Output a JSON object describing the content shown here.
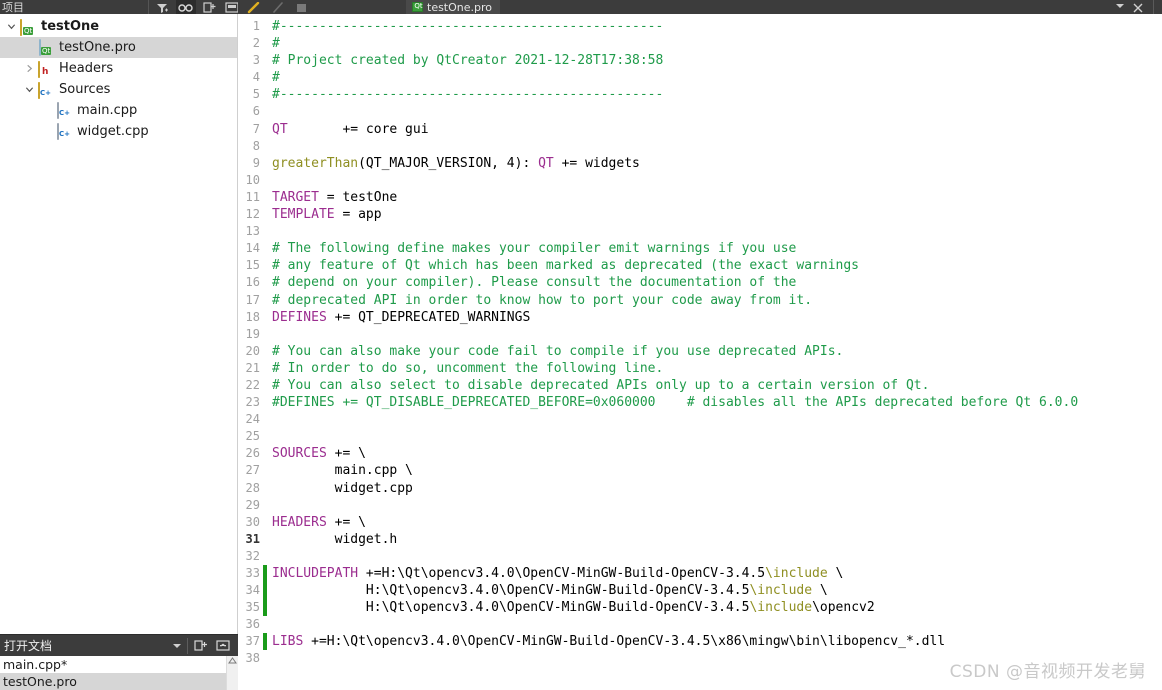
{
  "toolbar": {
    "projects_label": "项目",
    "filter_icon": "filter-icon",
    "link_icon": "link-with-editor-icon",
    "split_icon": "add-split-icon",
    "close_split_icon": "close-split-icon",
    "bookmark_icon": "bookmark-icon",
    "forward_icon": "forward-icon",
    "stop_icon": "stop-icon",
    "tab_label": "testOne.pro",
    "tab_icon": "qt-pro-file-icon",
    "tab_close_icon": "close-icon",
    "tab_dropdown_icon": "chevron-down-icon"
  },
  "sidebar": {
    "items": [
      {
        "label": "testOne",
        "icon": "qt-project-icon",
        "indent": 0,
        "twisty": "expanded",
        "bold": true,
        "selected": false
      },
      {
        "label": "testOne.pro",
        "icon": "qt-pro-file-icon",
        "indent": 1,
        "twisty": "none",
        "bold": false,
        "selected": true
      },
      {
        "label": "Headers",
        "icon": "headers-folder-icon",
        "indent": 1,
        "twisty": "collapsed",
        "bold": false,
        "selected": false
      },
      {
        "label": "Sources",
        "icon": "sources-folder-icon",
        "indent": 1,
        "twisty": "expanded",
        "bold": false,
        "selected": false
      },
      {
        "label": "main.cpp",
        "icon": "cpp-file-icon",
        "indent": 2,
        "twisty": "none",
        "bold": false,
        "selected": false
      },
      {
        "label": "widget.cpp",
        "icon": "cpp-file-icon",
        "indent": 2,
        "twisty": "none",
        "bold": false,
        "selected": false
      }
    ]
  },
  "open_documents": {
    "title": "打开文档",
    "dropdown_icon": "chevron-down-icon",
    "split_icon": "add-view-icon",
    "close_icon": "close-view-icon",
    "scroll_up_icon": "scroll-up-arrow-icon",
    "items": [
      {
        "label": "main.cpp*",
        "selected": false
      },
      {
        "label": "testOne.pro",
        "selected": true
      }
    ]
  },
  "editor": {
    "current_line": 31,
    "lines": [
      {
        "n": 1,
        "changed": false,
        "tokens": [
          {
            "t": "#-------------------------------------------------",
            "c": "cm"
          }
        ]
      },
      {
        "n": 2,
        "changed": false,
        "tokens": [
          {
            "t": "#",
            "c": "cm"
          }
        ]
      },
      {
        "n": 3,
        "changed": false,
        "tokens": [
          {
            "t": "# Project created by QtCreator 2021-12-28T17:38:58",
            "c": "cm"
          }
        ]
      },
      {
        "n": 4,
        "changed": false,
        "tokens": [
          {
            "t": "#",
            "c": "cm"
          }
        ]
      },
      {
        "n": 5,
        "changed": false,
        "tokens": [
          {
            "t": "#-------------------------------------------------",
            "c": "cm"
          }
        ]
      },
      {
        "n": 6,
        "changed": false,
        "tokens": []
      },
      {
        "n": 7,
        "changed": false,
        "tokens": [
          {
            "t": "QT",
            "c": "kw"
          },
          {
            "t": "       += core gui",
            "c": "op"
          }
        ]
      },
      {
        "n": 8,
        "changed": false,
        "tokens": []
      },
      {
        "n": 9,
        "changed": false,
        "tokens": [
          {
            "t": "greaterThan",
            "c": "fn"
          },
          {
            "t": "(QT_MAJOR_VERSION, 4): ",
            "c": "op"
          },
          {
            "t": "QT",
            "c": "kw"
          },
          {
            "t": " += widgets",
            "c": "op"
          }
        ]
      },
      {
        "n": 10,
        "changed": false,
        "tokens": []
      },
      {
        "n": 11,
        "changed": false,
        "tokens": [
          {
            "t": "TARGET",
            "c": "kw"
          },
          {
            "t": " = testOne",
            "c": "op"
          }
        ]
      },
      {
        "n": 12,
        "changed": false,
        "tokens": [
          {
            "t": "TEMPLATE",
            "c": "kw"
          },
          {
            "t": " = app",
            "c": "op"
          }
        ]
      },
      {
        "n": 13,
        "changed": false,
        "tokens": []
      },
      {
        "n": 14,
        "changed": false,
        "tokens": [
          {
            "t": "# The following define makes your compiler emit warnings if you use",
            "c": "cm"
          }
        ]
      },
      {
        "n": 15,
        "changed": false,
        "tokens": [
          {
            "t": "# any feature of Qt which has been marked as deprecated (the exact warnings",
            "c": "cm"
          }
        ]
      },
      {
        "n": 16,
        "changed": false,
        "tokens": [
          {
            "t": "# depend on your compiler). Please consult the documentation of the",
            "c": "cm"
          }
        ]
      },
      {
        "n": 17,
        "changed": false,
        "tokens": [
          {
            "t": "# deprecated API in order to know how to port your code away from it.",
            "c": "cm"
          }
        ]
      },
      {
        "n": 18,
        "changed": false,
        "tokens": [
          {
            "t": "DEFINES",
            "c": "kw"
          },
          {
            "t": " += QT_DEPRECATED_WARNINGS",
            "c": "op"
          }
        ]
      },
      {
        "n": 19,
        "changed": false,
        "tokens": []
      },
      {
        "n": 20,
        "changed": false,
        "tokens": [
          {
            "t": "# You can also make your code fail to compile if you use deprecated APIs.",
            "c": "cm"
          }
        ]
      },
      {
        "n": 21,
        "changed": false,
        "tokens": [
          {
            "t": "# In order to do so, uncomment the following line.",
            "c": "cm"
          }
        ]
      },
      {
        "n": 22,
        "changed": false,
        "tokens": [
          {
            "t": "# You can also select to disable deprecated APIs only up to a certain version of Qt.",
            "c": "cm"
          }
        ]
      },
      {
        "n": 23,
        "changed": false,
        "tokens": [
          {
            "t": "#DEFINES += QT_DISABLE_DEPRECATED_BEFORE=0x060000    # disables all the APIs deprecated before Qt 6.0.0",
            "c": "cm"
          }
        ]
      },
      {
        "n": 24,
        "changed": false,
        "tokens": []
      },
      {
        "n": 25,
        "changed": false,
        "tokens": []
      },
      {
        "n": 26,
        "changed": false,
        "tokens": [
          {
            "t": "SOURCES",
            "c": "kw"
          },
          {
            "t": " += \\",
            "c": "op"
          }
        ]
      },
      {
        "n": 27,
        "changed": false,
        "tokens": [
          {
            "t": "        main.cpp \\",
            "c": "op"
          }
        ]
      },
      {
        "n": 28,
        "changed": false,
        "tokens": [
          {
            "t": "        widget.cpp",
            "c": "op"
          }
        ]
      },
      {
        "n": 29,
        "changed": false,
        "tokens": []
      },
      {
        "n": 30,
        "changed": false,
        "tokens": [
          {
            "t": "HEADERS",
            "c": "kw"
          },
          {
            "t": " += \\",
            "c": "op"
          }
        ]
      },
      {
        "n": 31,
        "changed": false,
        "tokens": [
          {
            "t": "        widget.h",
            "c": "op"
          }
        ]
      },
      {
        "n": 32,
        "changed": false,
        "tokens": []
      },
      {
        "n": 33,
        "changed": true,
        "tokens": [
          {
            "t": "INCLUDEPATH",
            "c": "kw"
          },
          {
            "t": " +=H:\\Qt\\opencv3.4.0\\OpenCV-MinGW-Build-OpenCV-3.4.5",
            "c": "op"
          },
          {
            "t": "\\include",
            "c": "fn"
          },
          {
            "t": " \\",
            "c": "op"
          }
        ]
      },
      {
        "n": 34,
        "changed": true,
        "tokens": [
          {
            "t": "            H:\\Qt\\opencv3.4.0\\OpenCV-MinGW-Build-OpenCV-3.4.5",
            "c": "op"
          },
          {
            "t": "\\include",
            "c": "fn"
          },
          {
            "t": " \\",
            "c": "op"
          }
        ]
      },
      {
        "n": 35,
        "changed": true,
        "tokens": [
          {
            "t": "            H:\\Qt\\opencv3.4.0\\OpenCV-MinGW-Build-OpenCV-3.4.5",
            "c": "op"
          },
          {
            "t": "\\include",
            "c": "fn"
          },
          {
            "t": "\\opencv2",
            "c": "op"
          }
        ]
      },
      {
        "n": 36,
        "changed": false,
        "tokens": []
      },
      {
        "n": 37,
        "changed": true,
        "tokens": [
          {
            "t": "LIBS",
            "c": "kw"
          },
          {
            "t": " +=H:\\Qt\\opencv3.4.0\\OpenCV-MinGW-Build-OpenCV-3.4.5\\x86\\mingw\\bin\\libopencv_*.dll",
            "c": "op"
          }
        ]
      },
      {
        "n": 38,
        "changed": false,
        "tokens": []
      }
    ]
  },
  "watermark": {
    "text": "CSDN @音视频开发老舅"
  },
  "colors": {
    "comment": "#1f9b4a",
    "keyword": "#9b2d8f",
    "function": "#8f8f22",
    "change_marker": "#1a9b1a",
    "toolbar_bg": "#3c3c3c",
    "selection_bg": "#d6d6d6"
  }
}
